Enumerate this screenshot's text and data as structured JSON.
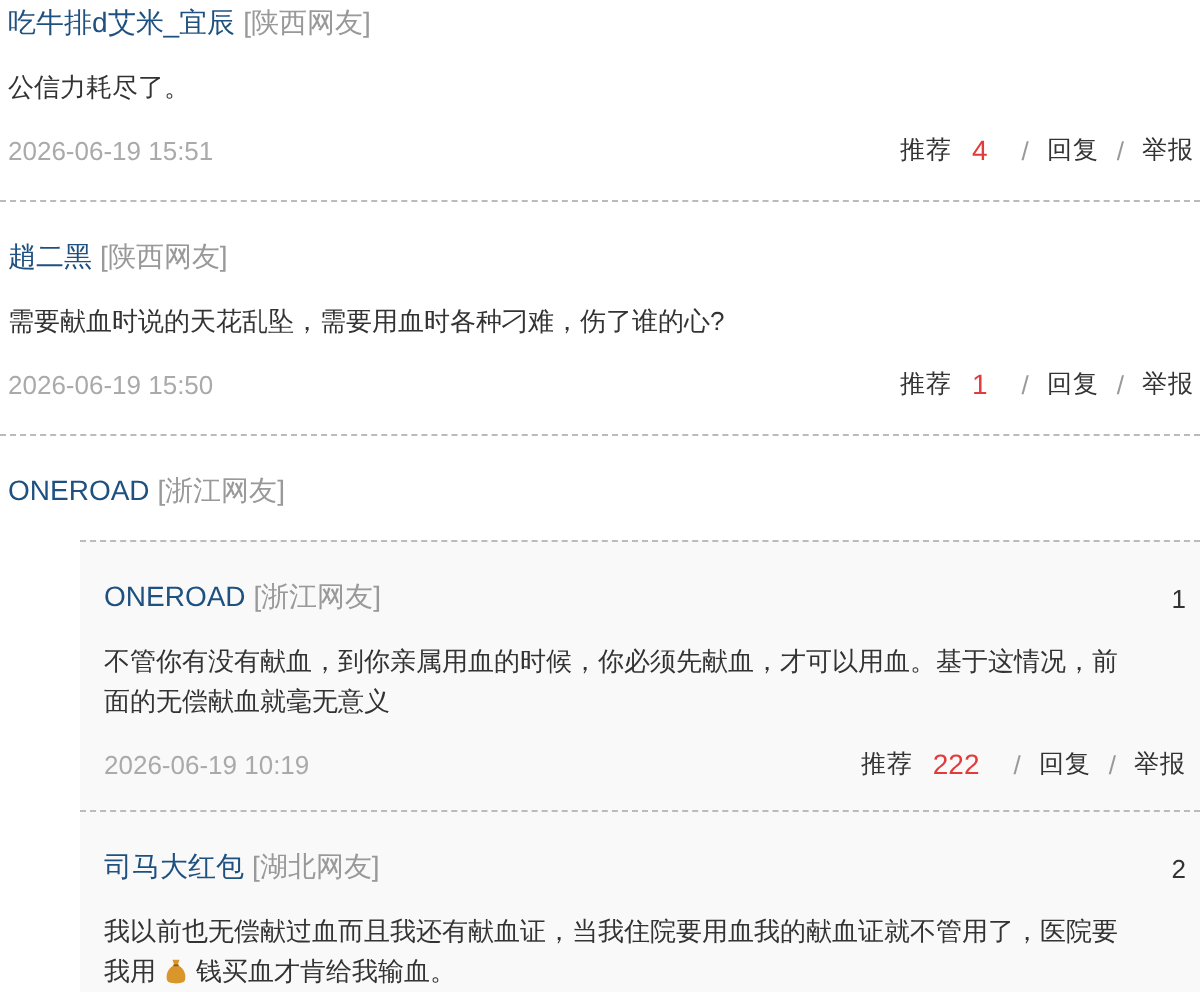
{
  "comments": [
    {
      "user": "吃牛排d艾米_宜辰",
      "region": "[陕西网友]",
      "lines": [
        [
          {
            "kind": "text",
            "text": "公信力耗尽了。"
          }
        ]
      ],
      "date": "2026-06-19 15:51",
      "recommend": "推荐",
      "likes": "4",
      "separator_1": "/",
      "reply": "回复",
      "separator_2": "/",
      "report": "举报"
    },
    {
      "user": "趙二黑",
      "region": "[陕西网友]",
      "lines": [
        [
          {
            "kind": "text",
            "text": "需要献血时说的天花乱坠，需要用血时各种刁难，伤了谁的心?"
          }
        ]
      ],
      "date": "2026-06-19 15:50",
      "recommend": "推荐",
      "likes": "1",
      "separator_1": "/",
      "reply": "回复",
      "separator_2": "/",
      "report": "举报"
    },
    {
      "user": "ONEROAD",
      "region": "[浙江网友]",
      "replies": [
        {
          "user": "ONEROAD",
          "region": "[浙江网友]",
          "floor": "1",
          "lines": [
            [
              {
                "kind": "text",
                "text": "不管你有没有献血，到你亲属用血的时候，你必须先献血，才可以用血。基于这情况，前"
              }
            ],
            [
              {
                "kind": "text",
                "text": "面的无偿献血就毫无意义"
              }
            ]
          ],
          "date": "2026-06-19 10:19",
          "recommend": "推荐",
          "likes": "222",
          "separator_1": "/",
          "reply": "回复",
          "separator_2": "/",
          "report": "举报"
        },
        {
          "user": "司马大红包",
          "region": "[湖北网友]",
          "floor": "2",
          "lines": [
            [
              {
                "kind": "text",
                "text": "我以前也无偿献过血而且我还有献血证，当我住院要用血我的献血证就不管用了，医院要"
              }
            ],
            [
              {
                "kind": "text",
                "text": "我用"
              },
              {
                "kind": "icon"
              },
              {
                "kind": "text",
                "text": "钱买血才肯给我输血。"
              }
            ]
          ]
        }
      ]
    }
  ]
}
